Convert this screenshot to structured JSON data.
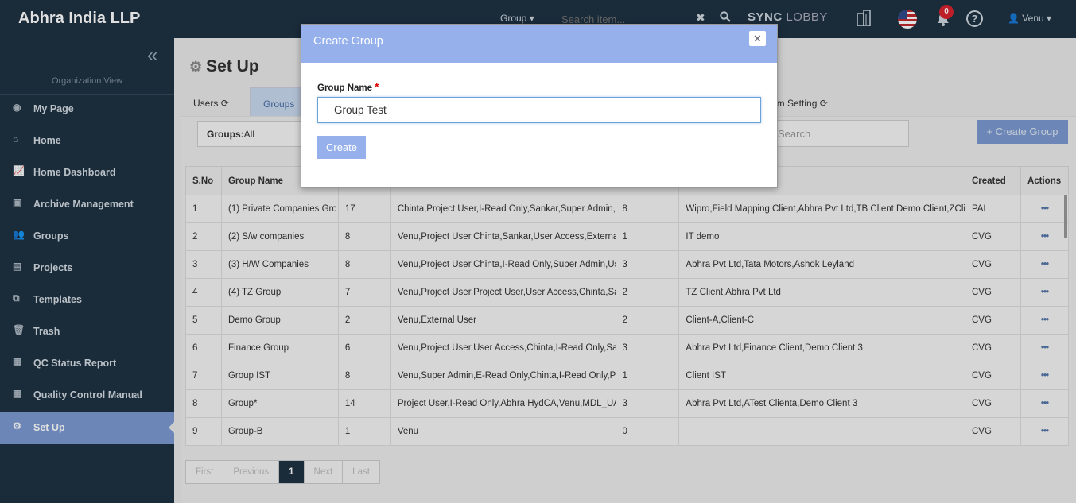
{
  "app": {
    "brand": "Abhra India LLP"
  },
  "topbar": {
    "group_label": "Group",
    "search_placeholder": "Search item...",
    "sync_a": "SYNC",
    "sync_b": "LOBBY",
    "notification_count": "0",
    "user": "Venu"
  },
  "sidebar": {
    "org_view": "Organization View",
    "items": [
      {
        "label": "My Page",
        "icon": "user-circle-icon"
      },
      {
        "label": "Home",
        "icon": "home-icon"
      },
      {
        "label": "Home Dashboard",
        "icon": "line-chart-icon"
      },
      {
        "label": "Archive Management",
        "icon": "archive-icon"
      },
      {
        "label": "Groups",
        "icon": "users-icon"
      },
      {
        "label": "Projects",
        "icon": "projects-icon"
      },
      {
        "label": "Templates",
        "icon": "templates-icon"
      },
      {
        "label": "Trash",
        "icon": "trash-icon"
      },
      {
        "label": "QC Status Report",
        "icon": "report-icon"
      },
      {
        "label": "Quality Control Manual",
        "icon": "manual-icon"
      },
      {
        "label": "Set Up",
        "icon": "gear-icon",
        "active": true
      }
    ]
  },
  "page": {
    "title": "Set Up",
    "tabs": [
      "Users",
      "Groups",
      "em Setting"
    ],
    "filter_label": "Groups:",
    "filter_value": "All",
    "search_placeholder": "Search",
    "create_group_label": "+ Create Group"
  },
  "table": {
    "headers": [
      "S.No",
      "Group Name",
      "",
      "",
      "",
      "",
      "Created",
      "Actions"
    ],
    "rows": [
      [
        "1",
        "(1) Private Companies Grc",
        "17",
        "Chinta,Project User,I-Read Only,Sankar,Super Admin,U",
        "8",
        "Wipro,Field Mapping Client,Abhra Pvt Ltd,TB Client,Demo Client,ZClie",
        "PAL",
        "•••"
      ],
      [
        "2",
        "(2) S/w companies",
        "8",
        "Venu,Project User,Chinta,Sankar,User Access,Externa",
        "1",
        "IT demo",
        "CVG",
        "•••"
      ],
      [
        "3",
        "(3) H/W Companies",
        "8",
        "Venu,Project User,Chinta,I-Read Only,Super Admin,Us",
        "3",
        "Abhra Pvt Ltd,Tata Motors,Ashok Leyland",
        "CVG",
        "•••"
      ],
      [
        "4",
        "(4) TZ Group",
        "7",
        "Venu,Project User,Project User,User Access,Chinta,Sa",
        "2",
        "TZ Client,Abhra Pvt Ltd",
        "CVG",
        "•••"
      ],
      [
        "5",
        "Demo Group",
        "2",
        "Venu,External User",
        "2",
        "Client-A,Client-C",
        "CVG",
        "•••"
      ],
      [
        "6",
        "Finance Group",
        "6",
        "Venu,Project User,User Access,Chinta,I-Read Only,Sa",
        "3",
        "Abhra Pvt Ltd,Finance Client,Demo Client 3",
        "CVG",
        "•••"
      ],
      [
        "7",
        "Group IST",
        "8",
        "Venu,Super Admin,E-Read Only,Chinta,I-Read Only,Pr",
        "1",
        "Client IST",
        "CVG",
        "•••"
      ],
      [
        "8",
        "Group*",
        "14",
        "Project User,I-Read Only,Abhra HydCA,Venu,MDL_UA",
        "3",
        "Abhra Pvt Ltd,ATest Clienta,Demo Client 3",
        "CVG",
        "•••"
      ],
      [
        "9",
        "Group-B",
        "1",
        "Venu",
        "0",
        "",
        "CVG",
        "•••"
      ]
    ]
  },
  "pager": [
    "First",
    "Previous",
    "1",
    "Next",
    "Last"
  ],
  "modal": {
    "title": "Create Group",
    "close": "✕",
    "field_label": "Group Name",
    "required_mark": "*",
    "field_value": "Group Test",
    "submit_label": "Create"
  }
}
